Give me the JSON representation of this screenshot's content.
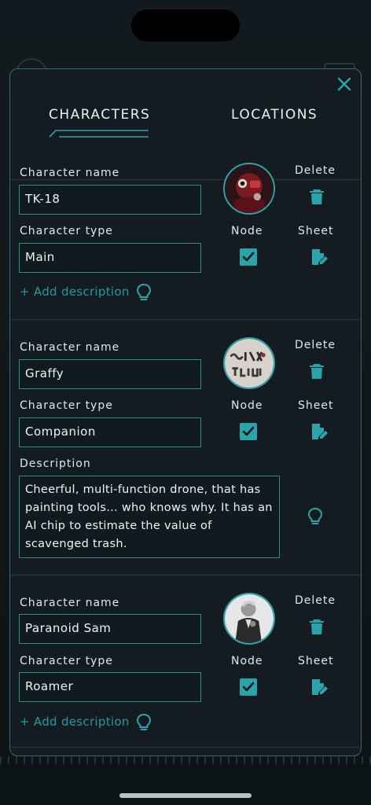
{
  "tabs": [
    {
      "label": "CHARACTERS",
      "active": true
    },
    {
      "label": "LOCATIONS",
      "active": false
    }
  ],
  "labels": {
    "character_name": "Character name",
    "character_type": "Character type",
    "description": "Description",
    "delete": "Delete",
    "node": "Node",
    "sheet": "Sheet",
    "add_description": "+ Add description"
  },
  "characters": [
    {
      "name": "TK-18",
      "type": "Main",
      "node_checked": true,
      "description": null
    },
    {
      "name": "Graffy",
      "type": "Companion",
      "node_checked": true,
      "description": "Cheerful, multi-function drone, that has painting tools... who knows why. It has an AI chip to estimate the value of scavenged trash."
    },
    {
      "name": "Paranoid Sam",
      "type": "Roamer",
      "node_checked": true,
      "description": null
    }
  ],
  "colors": {
    "accent": "#2ba3aa",
    "border": "#2f6d74",
    "panel": "#141c21"
  },
  "icons": [
    "close-icon",
    "trash-icon",
    "checkbox-checked-icon",
    "edit-sheet-icon",
    "lightbulb-icon"
  ]
}
